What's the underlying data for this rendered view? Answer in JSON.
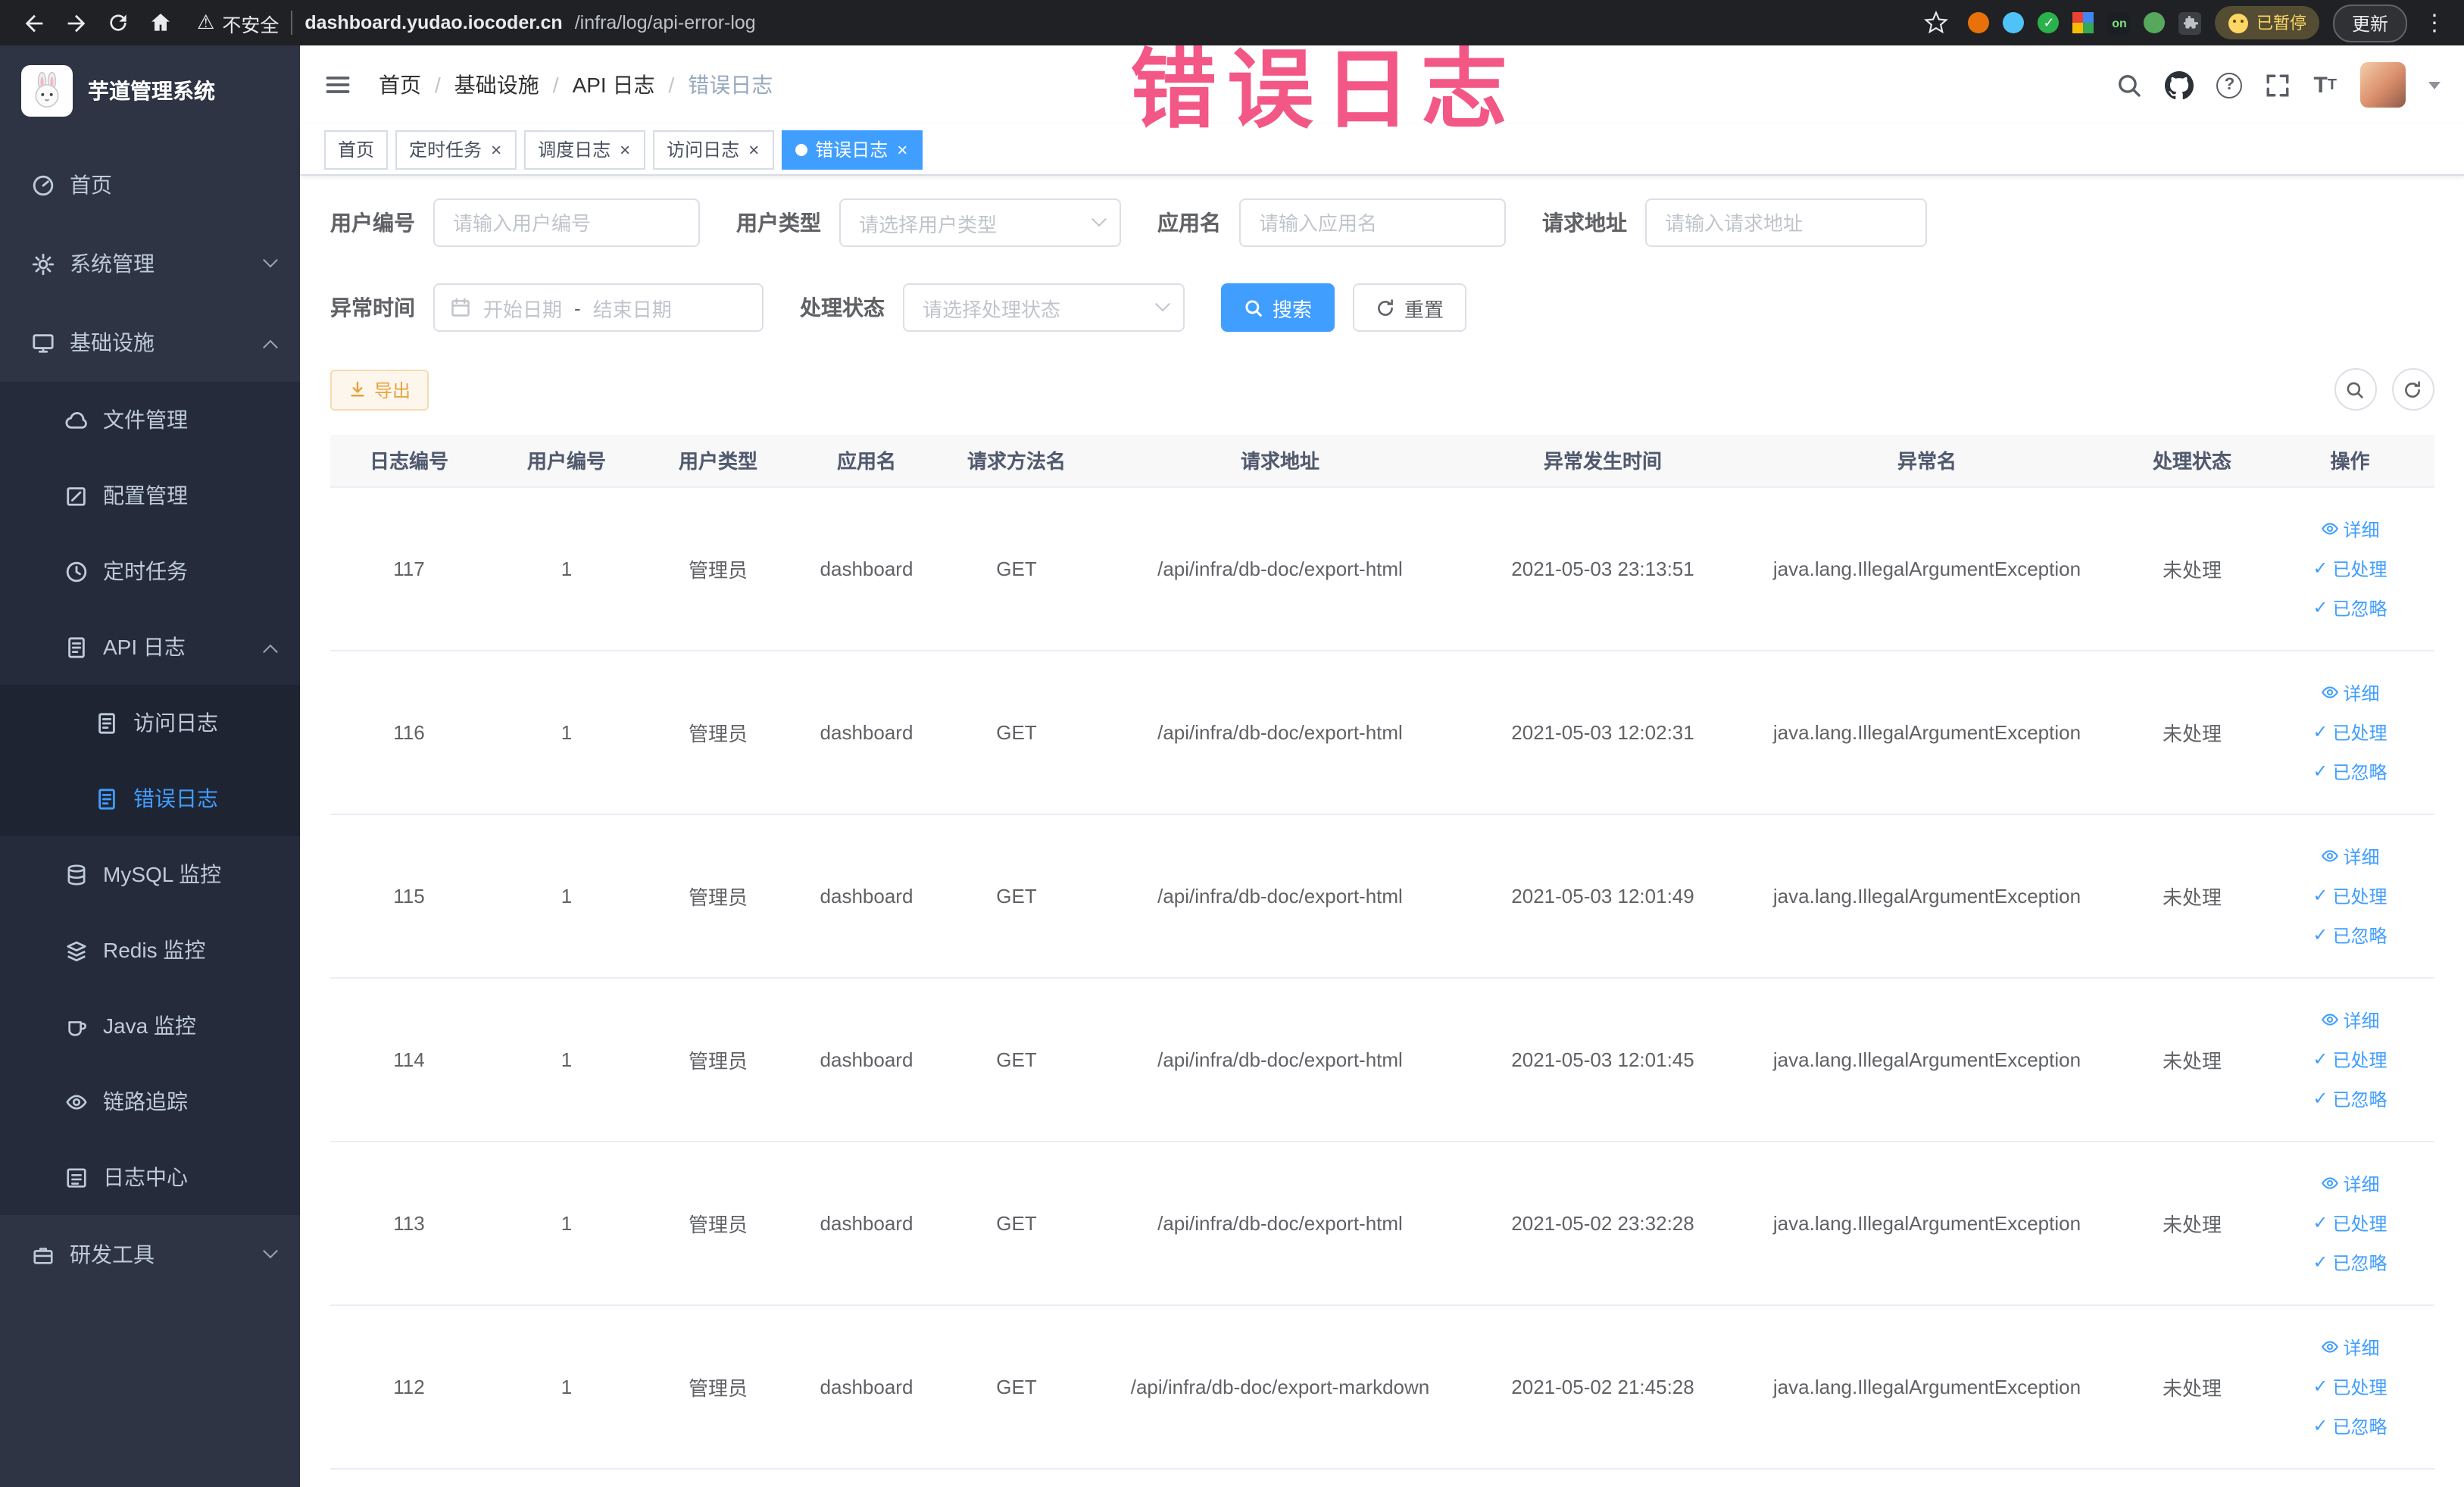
{
  "browser": {
    "security_label": "不安全",
    "url_host": "dashboard.yudao.iocoder.cn",
    "url_path": "/infra/log/api-error-log",
    "paused_badge": "已暂停",
    "update_button": "更新",
    "extension_badge_on": "on"
  },
  "annotation": {
    "text": "错误日志"
  },
  "sidebar": {
    "logo_title": "芋道管理系统",
    "items": [
      {
        "label": "首页"
      },
      {
        "label": "系统管理"
      },
      {
        "label": "基础设施"
      },
      {
        "label": "文件管理"
      },
      {
        "label": "配置管理"
      },
      {
        "label": "定时任务"
      },
      {
        "label": "API 日志"
      },
      {
        "label": "访问日志"
      },
      {
        "label": "错误日志"
      },
      {
        "label": "MySQL 监控"
      },
      {
        "label": "Redis 监控"
      },
      {
        "label": "Java 监控"
      },
      {
        "label": "链路追踪"
      },
      {
        "label": "日志中心"
      },
      {
        "label": "研发工具"
      }
    ]
  },
  "header": {
    "breadcrumb": [
      "首页",
      "基础设施",
      "API 日志",
      "错误日志"
    ],
    "separator": "/"
  },
  "tabs": [
    {
      "label": "首页"
    },
    {
      "label": "定时任务"
    },
    {
      "label": "调度日志"
    },
    {
      "label": "访问日志"
    },
    {
      "label": "错误日志"
    }
  ],
  "ui": {
    "close_glyph": "×",
    "check_glyph": "✓"
  },
  "filters": {
    "user_id_label": "用户编号",
    "user_id_placeholder": "请输入用户编号",
    "user_type_label": "用户类型",
    "user_type_placeholder": "请选择用户类型",
    "app_name_label": "应用名",
    "app_name_placeholder": "请输入应用名",
    "request_url_label": "请求地址",
    "request_url_placeholder": "请输入请求地址",
    "exception_time_label": "异常时间",
    "start_placeholder": "开始日期",
    "range_separator": "-",
    "end_placeholder": "结束日期",
    "process_status_label": "处理状态",
    "process_status_placeholder": "请选择处理状态",
    "search_label": "搜索",
    "reset_label": "重置"
  },
  "toolbar": {
    "export_label": "导出"
  },
  "table": {
    "columns": [
      "日志编号",
      "用户编号",
      "用户类型",
      "应用名",
      "请求方法名",
      "请求地址",
      "异常发生时间",
      "异常名",
      "处理状态",
      "操作"
    ],
    "row_actions": [
      "详细",
      "已处理",
      "已忽略"
    ],
    "rows": [
      {
        "id": "117",
        "user_id": "1",
        "user_type": "管理员",
        "app": "dashboard",
        "method": "GET",
        "url": "/api/infra/db-doc/export-html",
        "time": "2021-05-03 23:13:51",
        "exception": "java.lang.IllegalArgumentException",
        "status": "未处理"
      },
      {
        "id": "116",
        "user_id": "1",
        "user_type": "管理员",
        "app": "dashboard",
        "method": "GET",
        "url": "/api/infra/db-doc/export-html",
        "time": "2021-05-03 12:02:31",
        "exception": "java.lang.IllegalArgumentException",
        "status": "未处理"
      },
      {
        "id": "115",
        "user_id": "1",
        "user_type": "管理员",
        "app": "dashboard",
        "method": "GET",
        "url": "/api/infra/db-doc/export-html",
        "time": "2021-05-03 12:01:49",
        "exception": "java.lang.IllegalArgumentException",
        "status": "未处理"
      },
      {
        "id": "114",
        "user_id": "1",
        "user_type": "管理员",
        "app": "dashboard",
        "method": "GET",
        "url": "/api/infra/db-doc/export-html",
        "time": "2021-05-03 12:01:45",
        "exception": "java.lang.IllegalArgumentException",
        "status": "未处理"
      },
      {
        "id": "113",
        "user_id": "1",
        "user_type": "管理员",
        "app": "dashboard",
        "method": "GET",
        "url": "/api/infra/db-doc/export-html",
        "time": "2021-05-02 23:32:28",
        "exception": "java.lang.IllegalArgumentException",
        "status": "未处理"
      },
      {
        "id": "112",
        "user_id": "1",
        "user_type": "管理员",
        "app": "dashboard",
        "method": "GET",
        "url": "/api/infra/db-doc/export-markdown",
        "time": "2021-05-02 21:45:28",
        "exception": "java.lang.IllegalArgumentException",
        "status": "未处理"
      }
    ]
  },
  "colors": {
    "accent": "#409eff",
    "warning": "#e6a23c",
    "annotation_pink": "#f2497c",
    "sidebar_bg": "#2f3444",
    "chrome_bar_bg": "#202124"
  }
}
